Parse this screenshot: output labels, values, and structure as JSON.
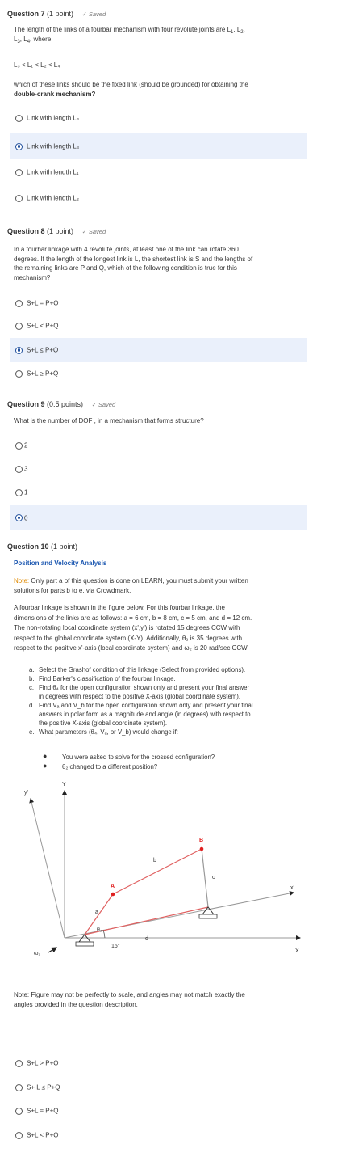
{
  "q7": {
    "title": "Question 7",
    "points": "(1 point)",
    "saved": "Saved",
    "text_1": "The length of the links of a fourbar mechanism  with four revolute joints are L",
    "text_2": "where,",
    "inequality": "L₃ < L₁ < L₂ < L₄",
    "text_3": "which of these links should be the fixed link (should be grounded) for obtaining the",
    "text_4": "double-crank mechanism?",
    "options": [
      "Link with length L₄",
      "Link with length L₃",
      "Link with length L₁",
      "Link with length L₂"
    ],
    "selected": 1
  },
  "q8": {
    "title": "Question 8",
    "points": "(1 point)",
    "saved": "Saved",
    "lines": [
      "In a fourbar linkage with 4 revolute joints, at least one of the link can rotate 360",
      "degrees. If the length of the longest link is L, the shortest link is S and the lengths of",
      "the remaining  links are P and Q, which of the  following condition   is true for this",
      "mechanism?"
    ],
    "options": [
      "S+L = P+Q",
      "S+L < P+Q",
      "S+L  ≤  P+Q",
      "S+L ≥  P+Q"
    ],
    "selected": 2
  },
  "q9": {
    "title": "Question 9",
    "points": "(0.5 points)",
    "saved": "Saved",
    "text": "What is the  number of DOF , in a mechanism that forms structure?",
    "options": [
      "2",
      "3",
      "1",
      "0"
    ],
    "selected": 3
  },
  "q10": {
    "title": "Question 10",
    "points": "(1 point)",
    "subtitle": "Position and Velocity Analysis",
    "note_label": "Note:",
    "note_text": " Only part a of this question is done on LEARN, you must submit your written",
    "note_text_2": "solutions for parts b to e, via Crowdmark.",
    "para": [
      "A fourbar linkage is shown in the figure below. For this fourbar linkage, the",
      "dimensions of the links are as follows: a = 6 cm, b = 8 cm, c = 5 cm, and d = 12 cm.",
      "The non-rotating local coordinate system (x',y') is rotated 15 degrees CCW with",
      "respect to the global coordinate system (X-Y). Additionally, θ₂ is 35 degrees with",
      "respect to the positive x'-axis (local coordinate system) and ω₂ is 20 rad/sec CCW."
    ],
    "list": [
      [
        "a.",
        "Select the Grashof condition of this linkage (Select from provided options)."
      ],
      [
        "b.",
        "Find Barker's classification of the fourbar linkage."
      ],
      [
        "c.",
        "Find θ₄ for the open configuration shown only and present your final answer"
      ],
      [
        "",
        "in degrees with respect to the positive X-axis (global coordinate system)."
      ],
      [
        "d.",
        "Find Vₐ and V_b for the open configuration shown only and present your final"
      ],
      [
        "",
        "answers in polar form as a magnitude and angle (in degrees) with respect to"
      ],
      [
        "",
        "the positive X-axis (global coordinate system)."
      ],
      [
        "e.",
        "What parameters (θ₄, Vₐ, or V_b) would change if:"
      ]
    ],
    "sublist": [
      "You were asked to solve for the crossed configuration?",
      "θ₂ changed to a different position?"
    ],
    "figure": {
      "y_prime": "y'",
      "y": "Y",
      "x_prime": "x'",
      "x": "X",
      "A": "A",
      "B": "B",
      "a": "a",
      "b": "b",
      "c": "c",
      "d": "d",
      "omega": "ω₂",
      "theta": "θ₂",
      "angle": "15°"
    },
    "fig_note_1": "Note: Figure may not be perfectly to scale, and angles may not match exactly the",
    "fig_note_2": "angles provided in the question description.",
    "options": [
      "S+L  >  P+Q",
      "S+ L ≤ P+Q",
      "S+L = P+Q",
      "S+L < P+Q"
    ],
    "selected": -1
  }
}
